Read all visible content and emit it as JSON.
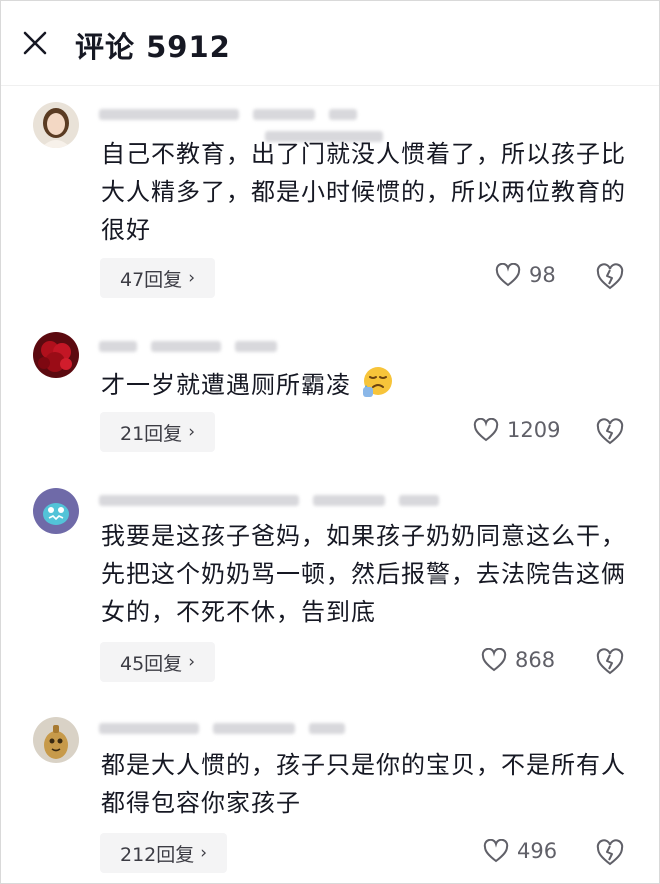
{
  "header": {
    "title": "评论 5912",
    "close_icon": "close-icon"
  },
  "comments": [
    {
      "text": "自己不教育，出了门就没人惯着了，所以孩子比大人精多了，都是小时候惯的，所以两位教育的很好",
      "replies_label": "47回复",
      "likes": "98"
    },
    {
      "text": "才一岁就遭遇厕所霸凌",
      "emoji": "crying-face-emoji",
      "replies_label": "21回复",
      "likes": "1209"
    },
    {
      "text": "我要是这孩子爸妈，如果孩子奶奶同意这么干，先把这个奶奶骂一顿，然后报警，去法院告这俩女的，不死不休，告到底",
      "replies_label": "45回复",
      "likes": "868"
    },
    {
      "text": "都是大人惯的，孩子只是你的宝贝，不是所有人都得包容你家孩子",
      "replies_label": "212回复",
      "likes": "496"
    }
  ],
  "icons": {
    "like": "heart-outline-icon",
    "dislike": "broken-heart-icon",
    "reply_chevron": "chevron-right-icon"
  },
  "colors": {
    "text": "#161823",
    "secondary": "#606068",
    "reply_bg": "#f4f4f5"
  }
}
